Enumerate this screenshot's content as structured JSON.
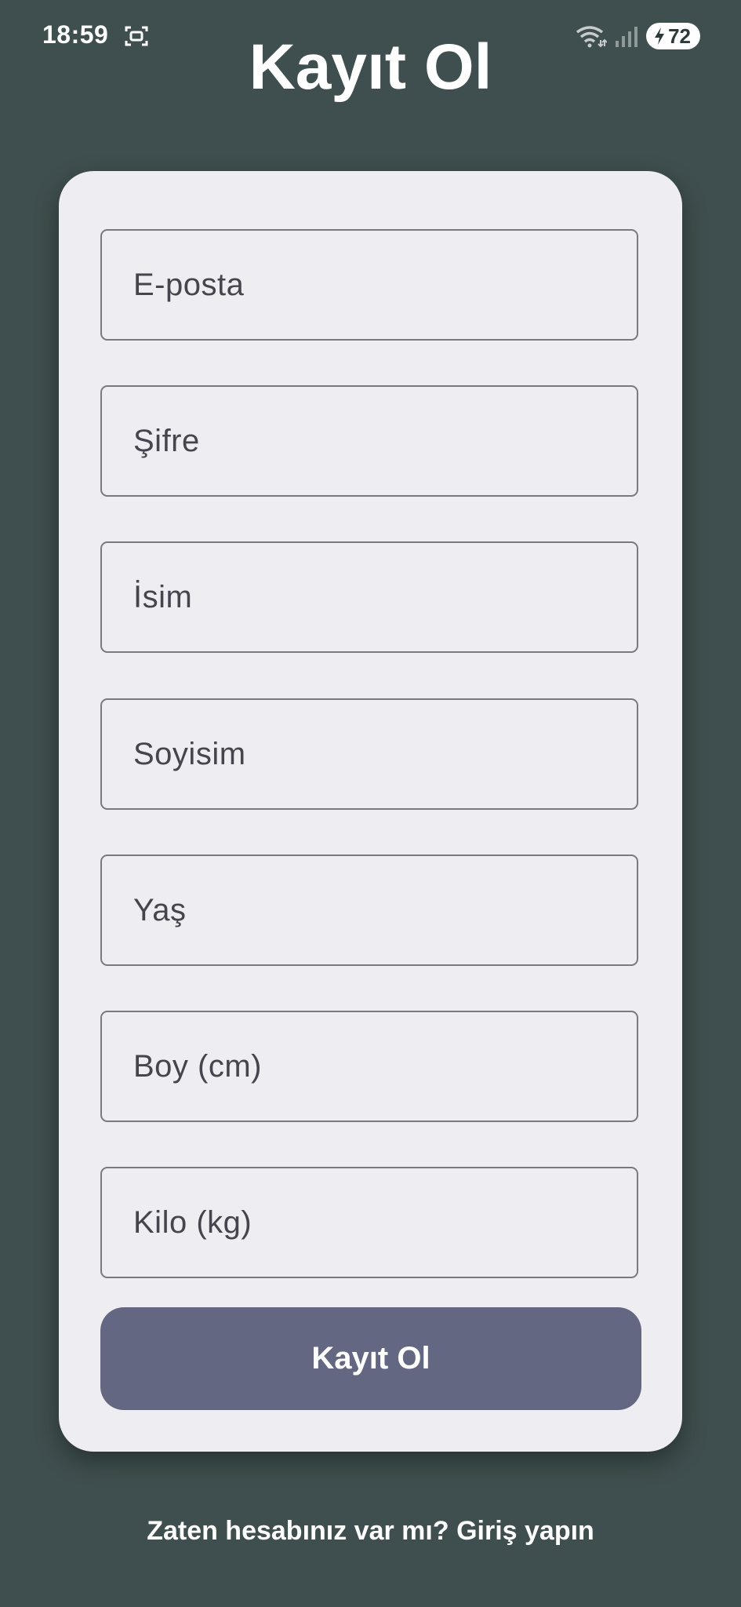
{
  "status_bar": {
    "time": "18:59",
    "battery_level": "72",
    "icons": [
      "screen-record-icon",
      "wifi-icon",
      "signal-icon",
      "battery-charging-icon"
    ]
  },
  "header": {
    "title": "Kayıt Ol"
  },
  "form": {
    "fields": [
      {
        "placeholder": "E-posta",
        "value": ""
      },
      {
        "placeholder": "Şifre",
        "value": ""
      },
      {
        "placeholder": "İsim",
        "value": ""
      },
      {
        "placeholder": "Soyisim",
        "value": ""
      },
      {
        "placeholder": "Yaş",
        "value": ""
      },
      {
        "placeholder": "Boy (cm)",
        "value": ""
      },
      {
        "placeholder": "Kilo (kg)",
        "value": ""
      }
    ],
    "submit_label": "Kayıt Ol"
  },
  "footer": {
    "login_link": "Zaten hesabınız var mı? Giriş yapın"
  },
  "colors": {
    "background": "#3f4e4e",
    "card": "#eeedf1",
    "button": "#646782",
    "field_border": "#7b787f"
  }
}
